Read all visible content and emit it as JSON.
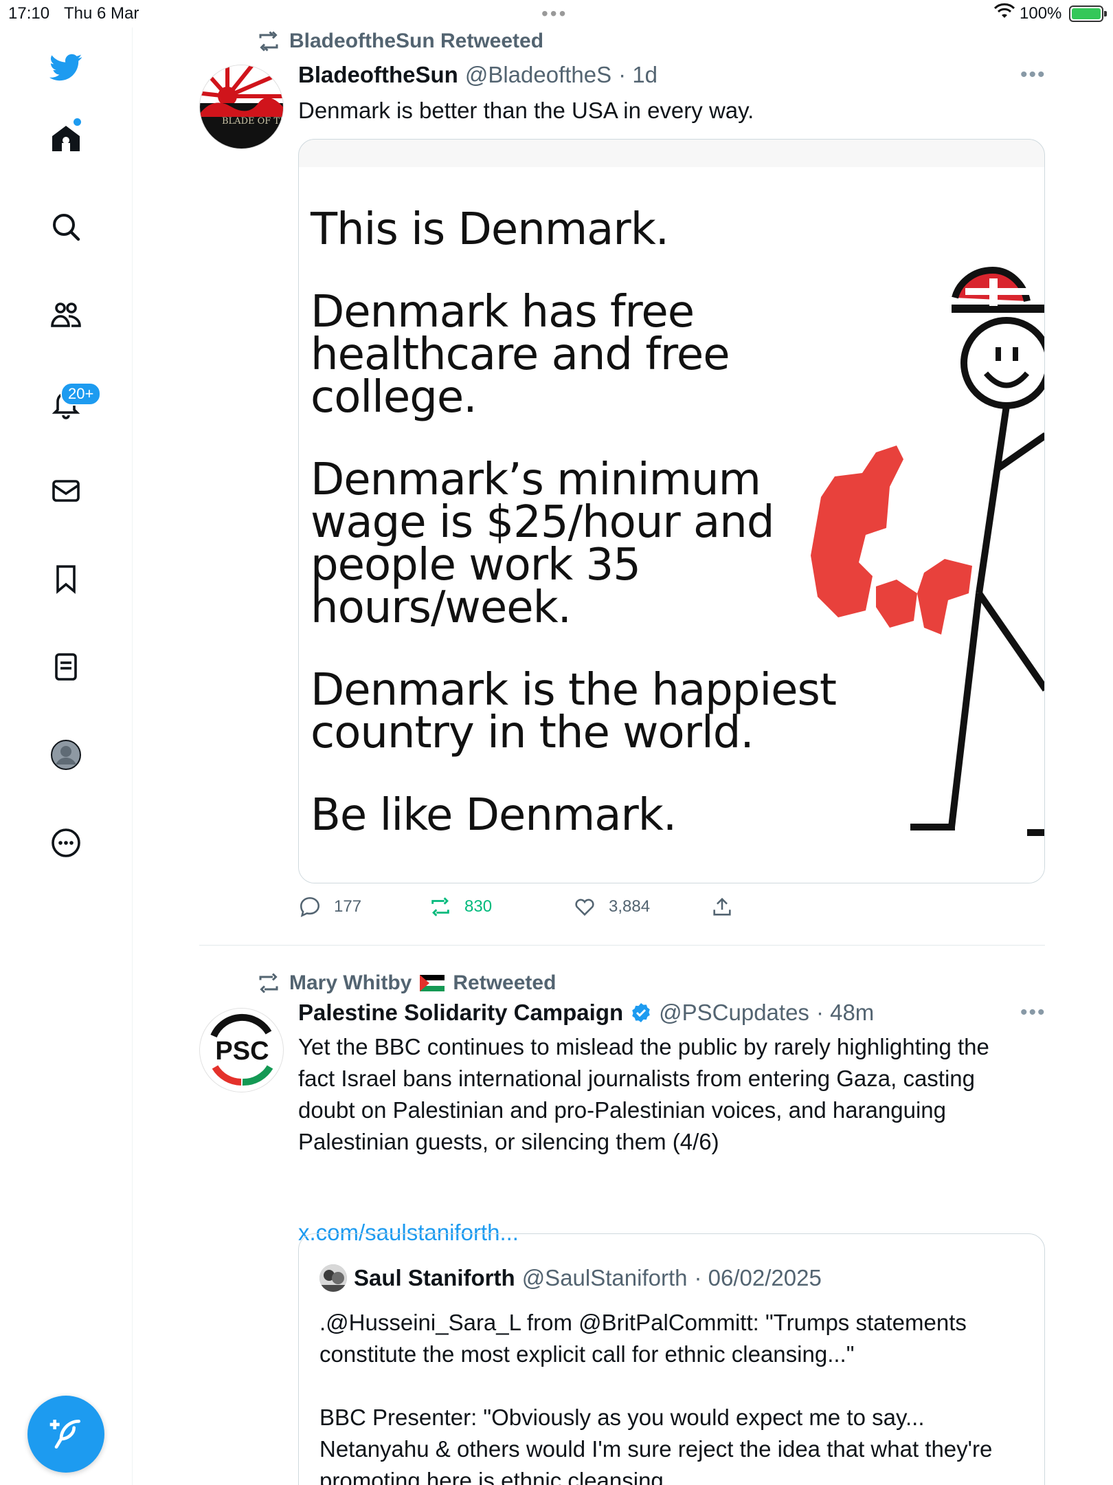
{
  "status_bar": {
    "time": "17:10",
    "date": "Thu 6 Mar",
    "battery_pct": "100%"
  },
  "sidebar": {
    "notifications_badge": "20+",
    "accent": "#1d9bf0"
  },
  "tweets": [
    {
      "retweeted_by": "BladeoftheSun Retweeted",
      "name": "BladeoftheSun",
      "handle": "@BladeoftheS",
      "time": "· 1d",
      "text": "Denmark is better than the USA in every way.",
      "avatar_text": "BLADE OF THE",
      "media": {
        "lines": [
          "This is Denmark.",
          "Denmark has free",
          "healthcare and free",
          "college.",
          "Denmark’s minimum",
          "wage is $25/hour and",
          "people work 35",
          "hours/week.",
          "Denmark is the happiest",
          "country in the world.",
          "Be like Denmark."
        ]
      },
      "replies": "177",
      "retweets": "830",
      "likes": "3,884"
    },
    {
      "retweeted_by": "Mary Whitby",
      "retweeted_suffix": "Retweeted",
      "name": "Palestine Solidarity Campaign",
      "handle": "@PSCupdates",
      "time": "· 48m",
      "avatar_text": "PSC",
      "text_lines": [
        "Yet the BBC continues to mislead the public by rarely highlighting the",
        "fact Israel bans international journalists from entering Gaza, casting",
        "doubt on Palestinian and pro-Palestinian voices, and haranguing",
        "Palestinian guests, or silencing them (4/6)"
      ],
      "link": "x.com/saulstaniforth...",
      "quote": {
        "name": "Saul Staniforth",
        "handle": "@SaulStaniforth",
        "time": "· 06/02/2025",
        "lines": [
          ".@Husseini_Sara_L from @BritPalCommitt: \"Trumps statements",
          "constitute the most explicit call for ethnic cleansing...\"",
          "",
          "BBC Presenter: \"Obviously as you would expect me to say...",
          "Netanyahu & others would I'm sure reject the idea that what they're",
          "promoting here is ethnic cleansing"
        ]
      }
    }
  ]
}
